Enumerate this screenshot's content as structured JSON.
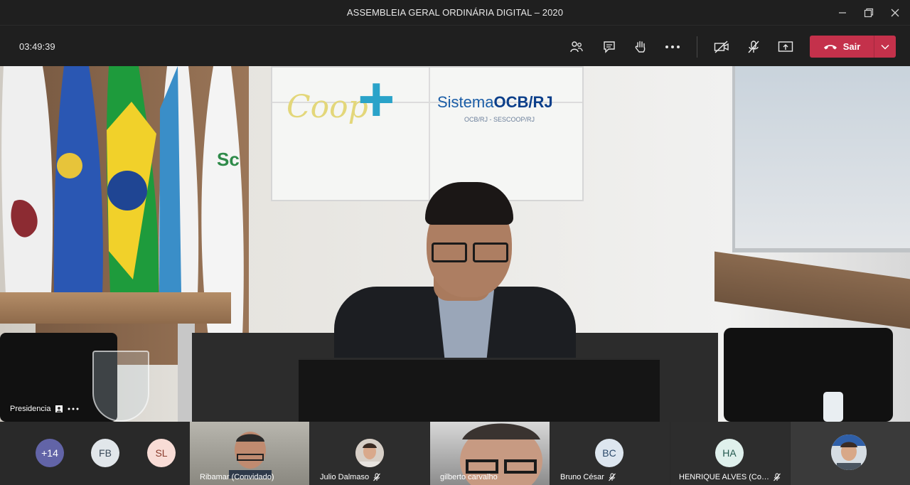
{
  "window": {
    "title": "ASSEMBLEIA GERAL ORDINÁRIA DIGITAL – 2020"
  },
  "toolbar": {
    "timer": "03:49:39",
    "leave_label": "Sair",
    "leave_color": "#c4314b"
  },
  "stage": {
    "speaker_name": "Presidencia",
    "screen_brand_bold": "OCB/RJ",
    "screen_brand_prefix": "Sistema",
    "screen_sub": "OCB/RJ - SESCOOP/RJ",
    "screen_logo_text": "Coop"
  },
  "participants": {
    "overflow_count": "+14",
    "avatars": [
      {
        "initials": "FB",
        "color": "#e1e6ea",
        "text_color": "#3a4a5a"
      },
      {
        "initials": "SL",
        "color": "#f8dcd6",
        "text_color": "#8a3b2c"
      }
    ],
    "video_tiles": [
      {
        "name": "Ribamar (Convidado)"
      },
      {
        "name": "Julio Dalmaso"
      },
      {
        "name": "gilberto carvalho"
      },
      {
        "name": "Bruno César",
        "initials": "BC"
      },
      {
        "name": "HENRIQUE ALVES (Co…",
        "initials": "HA"
      }
    ]
  }
}
